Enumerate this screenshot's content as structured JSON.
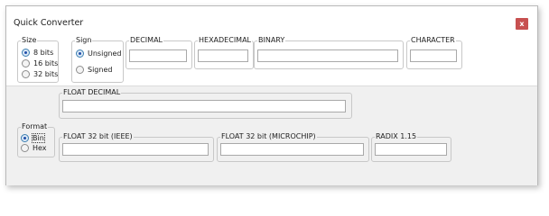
{
  "window": {
    "title": "Quick Converter",
    "close_label": "x"
  },
  "size_group": {
    "legend": "Size",
    "options": [
      {
        "label": "8 bits",
        "checked": true
      },
      {
        "label": "16 bits",
        "checked": false
      },
      {
        "label": "32 bits",
        "checked": false
      }
    ]
  },
  "sign_group": {
    "legend": "Sign",
    "options": [
      {
        "label": "Unsigned",
        "checked": true
      },
      {
        "label": "Signed",
        "checked": false
      }
    ]
  },
  "fields": {
    "decimal": {
      "legend": "DECIMAL",
      "value": ""
    },
    "hexadecimal": {
      "legend": "HEXADECIMAL",
      "value": ""
    },
    "binary": {
      "legend": "BINARY",
      "value": ""
    },
    "character": {
      "legend": "CHARACTER",
      "value": ""
    },
    "float_decimal": {
      "legend": "FLOAT DECIMAL",
      "value": ""
    },
    "float32_ieee": {
      "legend": "FLOAT 32 bit (IEEE)",
      "value": ""
    },
    "float32_microchip": {
      "legend": "FLOAT 32 bit (MICROCHIP)",
      "value": ""
    },
    "radix": {
      "legend": "RADIX 1.15",
      "value": ""
    }
  },
  "format_group": {
    "legend": "Format",
    "options": [
      {
        "label": "Bin",
        "checked": true
      },
      {
        "label": "Hex",
        "checked": false
      }
    ]
  },
  "colors": {
    "close_button": "#c75050",
    "lower_panel": "#f0f0f0"
  }
}
